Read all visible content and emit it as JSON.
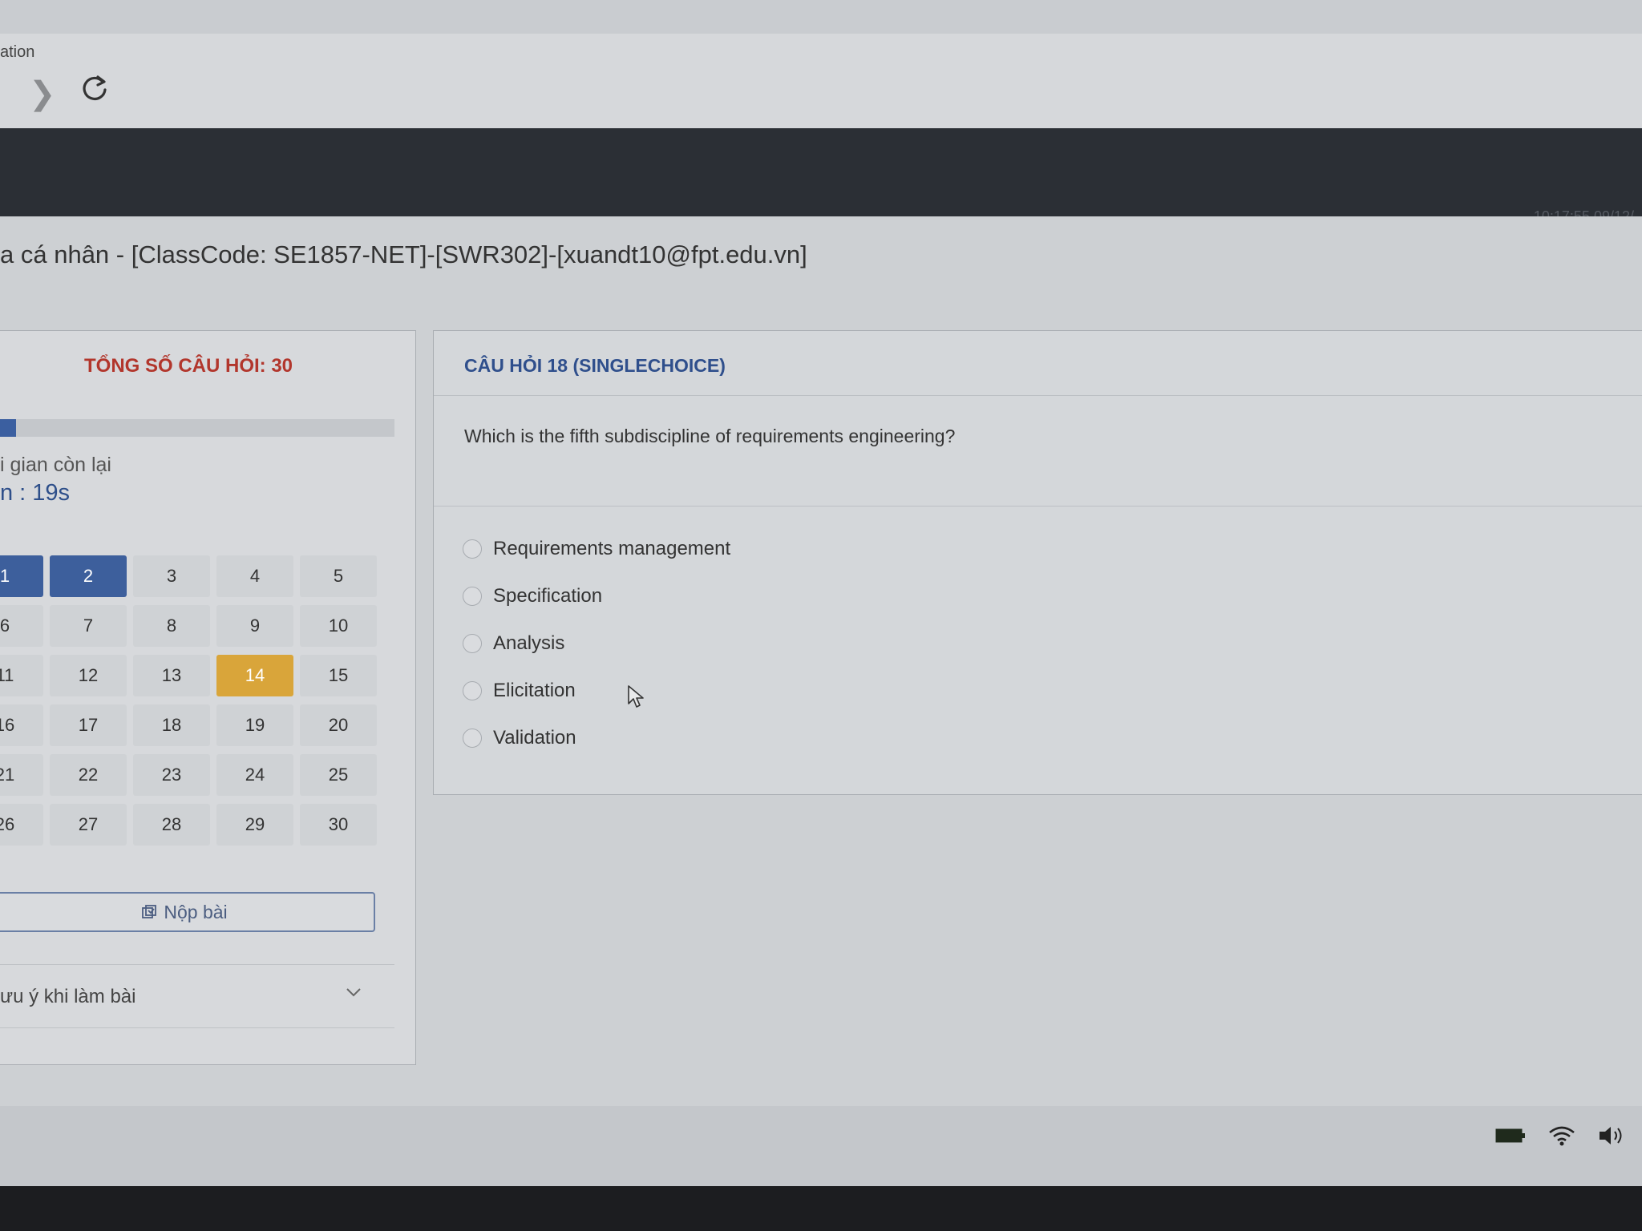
{
  "browser": {
    "tab_title": "ation"
  },
  "header": {
    "clock": "10:17:55 09/12/"
  },
  "exam": {
    "title": "a cá nhân - [ClassCode: SE1857-NET]-[SWR302]-[xuandt10@fpt.edu.vn]"
  },
  "sidebar": {
    "total_label": "TỔNG SỐ CÂU HỎI: 30",
    "progress_fraction": 0.04,
    "time_label": "i gian còn lại",
    "time_value": "n : 19s",
    "questions": [
      "1",
      "2",
      "3",
      "4",
      "5",
      "6",
      "7",
      "8",
      "9",
      "10",
      "11",
      "12",
      "13",
      "14",
      "15",
      "16",
      "17",
      "18",
      "19",
      "20",
      "21",
      "22",
      "23",
      "24",
      "25",
      "26",
      "27",
      "28",
      "29",
      "30"
    ],
    "done": [
      "1",
      "2"
    ],
    "flagged": [
      "14"
    ],
    "submit_label": "Nộp bài",
    "notes_label": "ưu ý khi làm bài"
  },
  "question": {
    "header": "CÂU HỎI 18 (SINGLECHOICE)",
    "text": "Which is the fifth subdiscipline of requirements engineering?",
    "options": [
      "Requirements management",
      "Specification",
      "Analysis",
      "Elicitation",
      "Validation"
    ]
  },
  "colors": {
    "accent": "#3d5f9c",
    "flag": "#d9a53a",
    "total_label": "#b2362c"
  },
  "icons": [
    "forward-arrow-icon",
    "reload-icon",
    "submit-icon",
    "chevron-down-icon",
    "battery-icon",
    "wifi-icon",
    "volume-icon"
  ]
}
